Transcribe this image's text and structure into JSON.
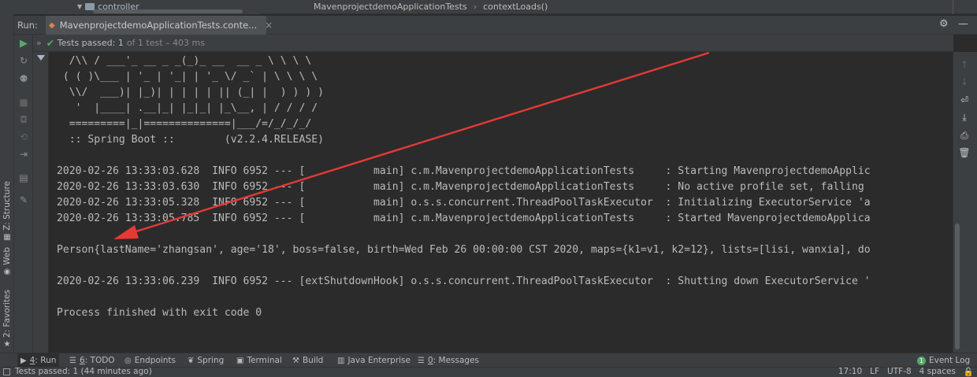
{
  "editor": {
    "tree_item": "controller",
    "breadcrumb": [
      "MavenprojectdemoApplicationTests",
      "contextLoads()"
    ],
    "breadcrumb_sep": "›"
  },
  "run": {
    "label": "Run:",
    "tab_title": "MavenprojectdemoApplicationTests.conte...",
    "tab_close": "×"
  },
  "icons": {
    "gear": "gear-icon",
    "minimize": "minimize-icon",
    "run": "run-icon",
    "check": "check-icon",
    "arrow_up": "arrow-up-icon",
    "arrow_down": "arrow-down-icon",
    "soft_wrap": "soft-wrap-icon",
    "scroll_to_end": "scroll-to-end-icon",
    "print": "print-icon",
    "trash": "trash-icon"
  },
  "test_status": {
    "passed": "Tests passed: 1",
    "of": "of 1 test – 403 ms"
  },
  "console": {
    "banner": [
      "  /\\\\ / ___'_ __ _ _(_)_ __  __ _ \\ \\ \\ \\",
      " ( ( )\\___ | '_ | '_| | '_ \\/ _` | \\ \\ \\ \\",
      "  \\\\/  ___)| |_)| | | | | || (_| |  ) ) ) )",
      "   '  |____| .__|_| |_|_| |_\\__, | / / / /",
      "  =========|_|==============|___/=/_/_/_/",
      "  :: Spring Boot ::        (v2.2.4.RELEASE)"
    ],
    "logs": [
      "2020-02-26 13:33:03.628  INFO 6952 --- [           main] c.m.MavenprojectdemoApplicationTests     : Starting MavenprojectdemoApplic",
      "2020-02-26 13:33:03.630  INFO 6952 --- [           main] c.m.MavenprojectdemoApplicationTests     : No active profile set, falling ",
      "2020-02-26 13:33:05.328  INFO 6952 --- [           main] o.s.s.concurrent.ThreadPoolTaskExecutor  : Initializing ExecutorService 'a",
      "2020-02-26 13:33:05.785  INFO 6952 --- [           main] c.m.MavenprojectdemoApplicationTests     : Started MavenprojectdemoApplica"
    ],
    "person": "Person{lastName='zhangsan', age='18', boss=false, birth=Wed Feb 26 00:00:00 CST 2020, maps={k1=v1, k2=12}, lists=[lisi, wanxia], do",
    "shutdown": "2020-02-26 13:33:06.239  INFO 6952 --- [extShutdownHook] o.s.s.concurrent.ThreadPoolTaskExecutor  : Shutting down ExecutorService '",
    "exit": "Process finished with exit code 0"
  },
  "side_tabs": {
    "structure": "Z: Structure",
    "web": "Web",
    "favorites": "2: Favorites"
  },
  "bottom_tabs": [
    {
      "num": "4",
      "label": ": Run"
    },
    {
      "num": "6",
      "label": ": TODO"
    },
    {
      "num": "",
      "label": "Endpoints"
    },
    {
      "num": "",
      "label": "Spring"
    },
    {
      "num": "",
      "label": "Terminal"
    },
    {
      "num": "",
      "label": "Build"
    },
    {
      "num": "",
      "label": "Java Enterprise"
    },
    {
      "num": "0",
      "label": ": Messages"
    }
  ],
  "event_log": {
    "badge": "1",
    "label": "Event Log"
  },
  "status_bar": {
    "message": "Tests passed: 1 (44 minutes ago)",
    "position": "17:10",
    "line_sep": "LF",
    "encoding": "UTF-8",
    "indent": "4 spaces"
  },
  "colors": {
    "background": "#2b2b2b",
    "panel": "#3c3f41",
    "text": "#bbbbbb",
    "success": "#59a869",
    "annotation_arrow": "#e53935"
  }
}
